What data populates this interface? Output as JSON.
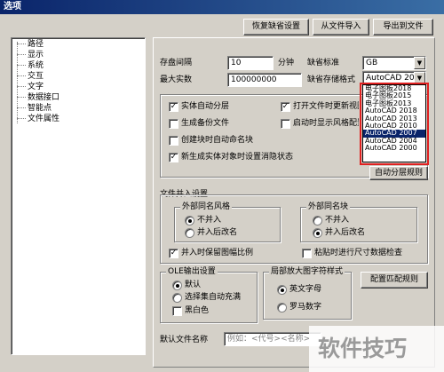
{
  "window": {
    "title": "选项"
  },
  "top_buttons": {
    "restore": "恢复缺省设置",
    "import": "从文件导入",
    "export": "导出到文件"
  },
  "tree": {
    "items": [
      "路径",
      "显示",
      "系统",
      "交互",
      "文字",
      "数据接口",
      "智能点",
      "文件属性"
    ]
  },
  "fields": {
    "save_interval_label": "存盘间隔",
    "save_interval_value": "10",
    "save_interval_unit": "分钟",
    "max_instances_label": "最大实数",
    "max_instances_value": "100000000",
    "default_standard_label": "缺省标准",
    "default_standard_value": "GB",
    "default_save_format_label": "缺省存储格式",
    "default_save_format_value": "AutoCAD 2007"
  },
  "format_options": [
    "电子图板2018",
    "电子图板2015",
    "电子图板2013",
    "AutoCAD 2018",
    "AutoCAD 2013",
    "AutoCAD 2010",
    "AutoCAD 2007",
    "AutoCAD 2004",
    "AutoCAD 2000"
  ],
  "format_selected": "AutoCAD 2007",
  "checkboxes": {
    "entity_auto_layer": "实体自动分层",
    "open_file_update_view": "打开文件时更新视图",
    "generate_backup": "生成备份文件",
    "auto_show_style": "启动时显示风格配置",
    "create_block_auto_name": "创建块时自动命名块",
    "new_entity_set_status": "新生成实体对象时设置消隐状态"
  },
  "buttons": {
    "auto_layer_rule": "自动分层规则",
    "config_match_rule": "配置匹配规则"
  },
  "file_merge": {
    "title": "文件并入设置",
    "external_style": "外部同名风格",
    "external_block": "外部同名块",
    "no_merge": "不并入",
    "merge_rename": "并入后改名",
    "keep_scale": "并入时保留图幅比例",
    "sticky_dimension": "粘贴时进行尺寸数据检查"
  },
  "ole": {
    "title": "OLE输出设置",
    "default": "默认",
    "select_fill": "选择集自动充满",
    "black_white": "黑白色"
  },
  "local_font": {
    "title": "局部放大图字符样式",
    "english": "英文字母",
    "roman": "罗马数字"
  },
  "default_filename": {
    "label": "默认文件名称",
    "placeholder": "例如：<代号><名称>"
  },
  "watermark": {
    "text": "软件技巧"
  }
}
